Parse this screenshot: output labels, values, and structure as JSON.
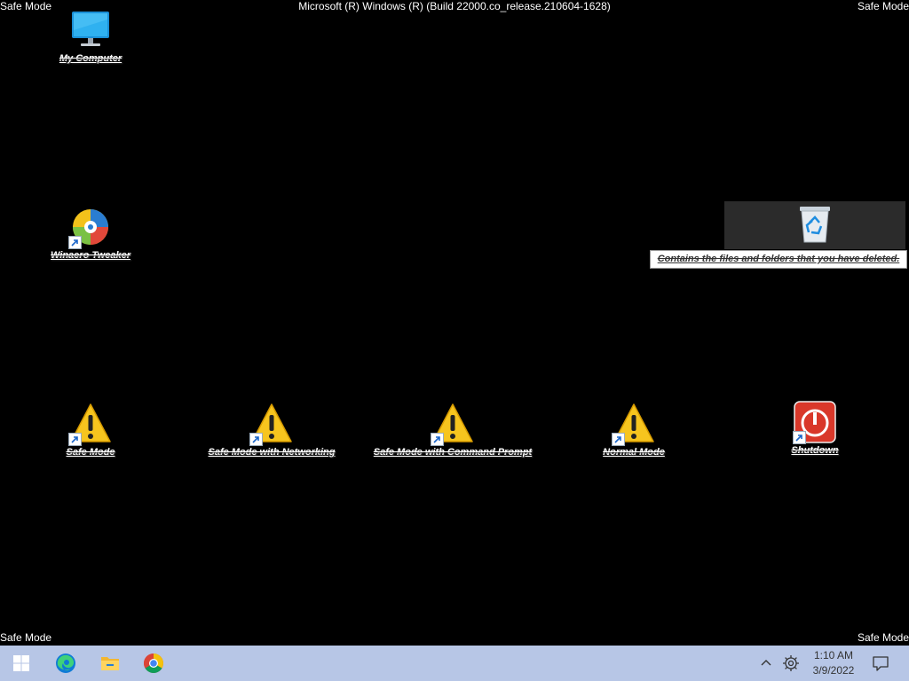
{
  "overlay": {
    "safe_mode_top_left": "Safe Mode",
    "safe_mode_top_right": "Safe Mode",
    "safe_mode_bottom_left": "Safe Mode",
    "safe_mode_bottom_right": "Safe Mode",
    "build_string": "Microsoft (R) Windows (R) (Build 22000.co_release.210604-1628)"
  },
  "desktop": {
    "icons": [
      {
        "label": "My Computer",
        "icon": "monitor-icon",
        "shortcut": false
      },
      {
        "label": "Winaero Tweaker",
        "icon": "winaero-tweaker-icon",
        "shortcut": true
      },
      {
        "label": "Safe Mode",
        "icon": "warning-icon",
        "shortcut": true
      },
      {
        "label": "Safe Mode with Networking",
        "icon": "warning-icon",
        "shortcut": true
      },
      {
        "label": "Safe Mode with Command Prompt",
        "icon": "warning-icon",
        "shortcut": true
      },
      {
        "label": "Normal Mode",
        "icon": "warning-icon",
        "shortcut": true
      },
      {
        "label": "Shutdown",
        "icon": "power-icon",
        "shortcut": true
      }
    ],
    "recycle_bin": {
      "icon": "recycle-bin-icon",
      "tooltip": "Contains the files and folders that you have deleted."
    }
  },
  "taskbar": {
    "buttons": [
      "windows-start-icon",
      "edge-icon",
      "file-explorer-icon",
      "chrome-icon"
    ],
    "tray": {
      "chevron": "chevron-up-icon",
      "settings": "gear-icon",
      "time": "1:10 AM",
      "date": "3/9/2022",
      "notifications": "notification-icon"
    }
  },
  "colors": {
    "desktop_background": "#000000",
    "taskbar_background": "#b7c6e6",
    "warning_yellow": "#f7c51e",
    "shutdown_red": "#d9382a"
  }
}
